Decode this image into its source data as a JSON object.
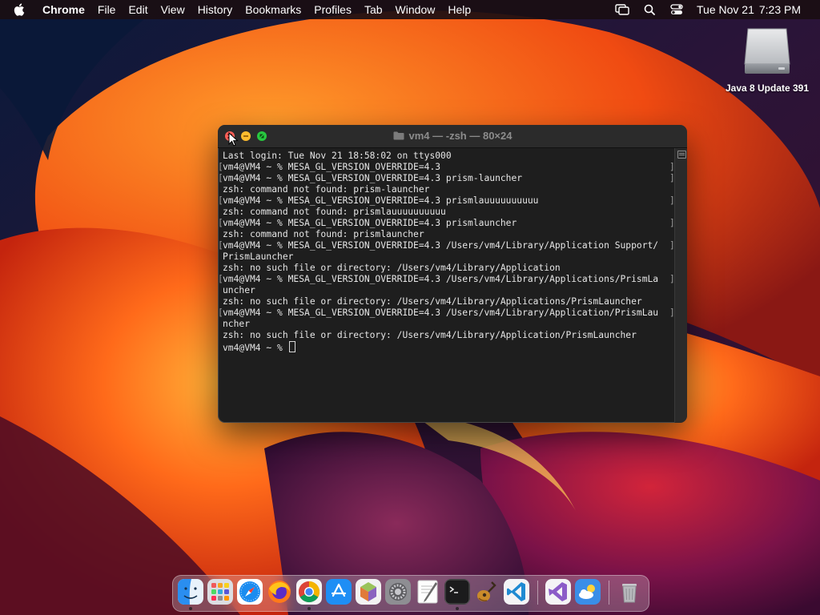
{
  "menubar": {
    "app_name": "Chrome",
    "items": [
      "File",
      "Edit",
      "View",
      "History",
      "Bookmarks",
      "Profiles",
      "Tab",
      "Window",
      "Help"
    ],
    "status_icons": [
      "screen-mirroring-icon",
      "search-icon",
      "control-center-icon"
    ],
    "date": "Tue Nov 21",
    "time": "7:23 PM"
  },
  "desktop": {
    "icons": [
      {
        "label": "Java 8 Update 391",
        "icon": "external-drive-icon"
      }
    ]
  },
  "terminal": {
    "title": "vm4 — -zsh — 80×24",
    "lines": [
      {
        "text": "Last login: Tue Nov 21 18:58:02 on ttys000",
        "mark": false
      },
      {
        "text": "vm4@VM4 ~ % MESA_GL_VERSION_OVERRIDE=4.3",
        "mark": true
      },
      {
        "text": "vm4@VM4 ~ % MESA_GL_VERSION_OVERRIDE=4.3 prism-launcher",
        "mark": true
      },
      {
        "text": "zsh: command not found: prism-launcher",
        "mark": false
      },
      {
        "text": "vm4@VM4 ~ % MESA_GL_VERSION_OVERRIDE=4.3 prismlauuuuuuuuuu",
        "mark": true
      },
      {
        "text": "zsh: command not found: prismlauuuuuuuuuu",
        "mark": false
      },
      {
        "text": "vm4@VM4 ~ % MESA_GL_VERSION_OVERRIDE=4.3 prismlauncher",
        "mark": true
      },
      {
        "text": "zsh: command not found: prismlauncher",
        "mark": false
      },
      {
        "text": "vm4@VM4 ~ % MESA_GL_VERSION_OVERRIDE=4.3 /Users/vm4/Library/Application Support/",
        "mark": true
      },
      {
        "text": "PrismLauncher",
        "mark": false
      },
      {
        "text": "zsh: no such file or directory: /Users/vm4/Library/Application",
        "mark": false
      },
      {
        "text": "vm4@VM4 ~ % MESA_GL_VERSION_OVERRIDE=4.3 /Users/vm4/Library/Applications/PrismLa",
        "mark": true
      },
      {
        "text": "uncher",
        "mark": false
      },
      {
        "text": "zsh: no such file or directory: /Users/vm4/Library/Applications/PrismLauncher",
        "mark": false
      },
      {
        "text": "vm4@VM4 ~ % MESA_GL_VERSION_OVERRIDE=4.3 /Users/vm4/Library/Application/PrismLau",
        "mark": true
      },
      {
        "text": "ncher",
        "mark": false
      },
      {
        "text": "zsh: no such file or directory: /Users/vm4/Library/Application/PrismLauncher",
        "mark": false
      }
    ],
    "prompt": "vm4@VM4 ~ % "
  },
  "dock": {
    "items": [
      {
        "name": "finder",
        "running": true
      },
      {
        "name": "launchpad",
        "running": false
      },
      {
        "name": "safari",
        "running": false
      },
      {
        "name": "firefox",
        "running": false
      },
      {
        "name": "chrome",
        "running": true
      },
      {
        "name": "app-store",
        "running": false
      },
      {
        "name": "prism-launcher",
        "running": false
      },
      {
        "name": "system-settings",
        "running": false
      },
      {
        "name": "textedit",
        "running": false
      },
      {
        "name": "terminal",
        "running": true
      },
      {
        "name": "garageband",
        "running": false
      },
      {
        "name": "vscode",
        "running": false
      },
      {
        "name": "visual-studio",
        "running": false
      },
      {
        "name": "weather",
        "running": false
      },
      {
        "name": "trash",
        "running": false
      }
    ]
  },
  "colors": {
    "close": "#ff5f57",
    "minimize": "#febc2e",
    "maximize": "#28c840",
    "terminal_bg": "#1e1e1e",
    "terminal_fg": "#e6e6e6"
  }
}
